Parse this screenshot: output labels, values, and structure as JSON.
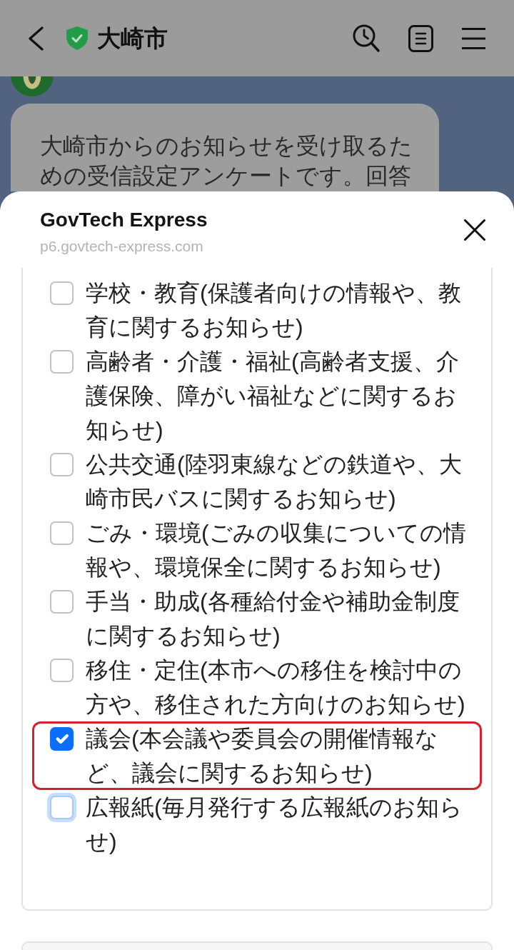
{
  "header": {
    "title": "大崎市"
  },
  "chat": {
    "message": "大崎市からのお知らせを受け取るための受信設定アンケートです。回答"
  },
  "sheet": {
    "title": "GovTech Express",
    "url": "p6.govtech-express.com"
  },
  "options": [
    {
      "label": "学校・教育(保護者向けの情報や、教育に関するお知らせ)",
      "checked": false,
      "focused": false,
      "highlighted": false
    },
    {
      "label": "高齢者・介護・福祉(高齢者支援、介護保険、障がい福祉などに関するお知らせ)",
      "checked": false,
      "focused": false,
      "highlighted": false
    },
    {
      "label": "公共交通(陸羽東線などの鉄道や、大崎市民バスに関するお知らせ)",
      "checked": false,
      "focused": false,
      "highlighted": false
    },
    {
      "label": "ごみ・環境(ごみの収集についての情報や、環境保全に関するお知らせ)",
      "checked": false,
      "focused": false,
      "highlighted": false
    },
    {
      "label": "手当・助成(各種給付金や補助金制度に関するお知らせ)",
      "checked": false,
      "focused": false,
      "highlighted": false
    },
    {
      "label": "移住・定住(本市への移住を検討中の方や、移住された方向けのお知らせ)",
      "checked": false,
      "focused": false,
      "highlighted": false
    },
    {
      "label": "議会(本会議や委員会の開催情報など、議会に関するお知らせ)",
      "checked": true,
      "focused": false,
      "highlighted": true
    },
    {
      "label": "広報紙(毎月発行する広報紙のお知らせ)",
      "checked": false,
      "focused": true,
      "highlighted": false
    }
  ]
}
